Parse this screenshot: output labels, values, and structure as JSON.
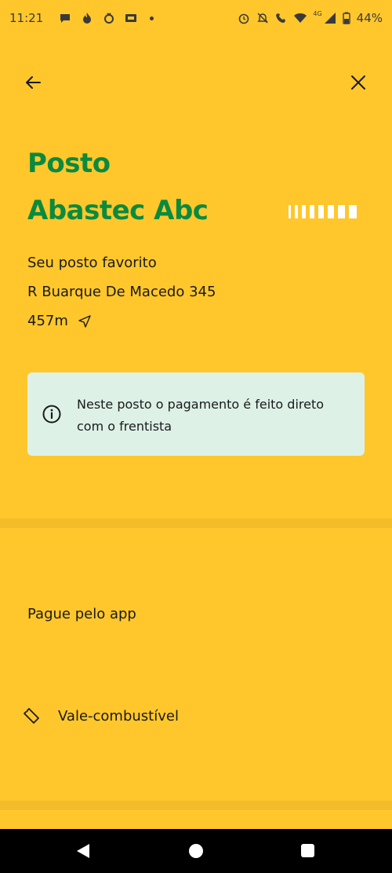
{
  "status_bar": {
    "time": "11:21",
    "network": "4G",
    "battery": "44%",
    "icons_left": [
      "chat-bubble-icon",
      "flame-icon",
      "fire-alert-icon",
      "cast-icon",
      "dot-icon"
    ],
    "icons_right": [
      "alarm-icon",
      "bell-off-icon",
      "wifi-call-icon",
      "wifi-icon",
      "signal-icon",
      "battery-icon"
    ]
  },
  "header": {
    "back_icon": "arrow-left-icon",
    "close_icon": "close-icon"
  },
  "station": {
    "title_line1": "Posto",
    "title_line2": "Abastec Abc",
    "favorite_label": "Seu posto favorito",
    "address": "R Buarque De Macedo 345",
    "distance": "457m",
    "distance_icon": "navigation-arrow-icon"
  },
  "notice": {
    "icon": "info-icon",
    "text": "Neste posto o pagamento é feito direto com o frentista"
  },
  "payment": {
    "section_title": "Pague pelo app",
    "voucher_icon": "ticket-icon",
    "voucher_label": "Vale-combustível"
  },
  "colors": {
    "background": "#FFC72C",
    "title_green": "#0B8A3E",
    "notice_bg": "#DDF1E7",
    "divider": "#F3BD2A"
  }
}
